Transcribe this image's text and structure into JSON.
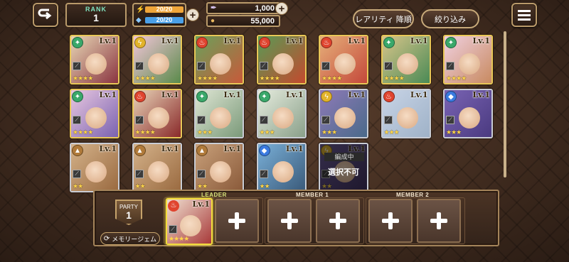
{
  "header": {
    "rank_label": "RANK",
    "rank_value": "1",
    "stamina_top": "20/20",
    "stamina_bottom": "20/20",
    "currency1_value": "1,000",
    "currency2_value": "55,000",
    "sort_button_label": "レアリティ 降順",
    "filter_button_label": "絞り込み"
  },
  "colors": {
    "accent_gold": "#e8c757",
    "frame": "#b99a6a",
    "leader_highlight": "#f3dd3e",
    "stamina_fill_top": "#f0a63a",
    "stamina_fill_bottom": "#4aa0e8"
  },
  "roster": [
    {
      "level": "Lv.1",
      "element": "wind",
      "frame": "gold",
      "art": [
        "#e8d7b5",
        "#8a3440"
      ],
      "stars": "★★★★",
      "status": "",
      "status_text": ""
    },
    {
      "level": "Lv.1",
      "element": "thunder",
      "frame": "gold",
      "art": [
        "#f2c6d8",
        "#5a8a4a"
      ],
      "stars": "★★★★",
      "status": "",
      "status_text": ""
    },
    {
      "level": "Lv.1",
      "element": "fire",
      "frame": "gold",
      "art": [
        "#6ba05a",
        "#c75a3a"
      ],
      "stars": "★★★★",
      "status": "",
      "status_text": ""
    },
    {
      "level": "Lv.1",
      "element": "fire",
      "frame": "gold",
      "art": [
        "#5a9a55",
        "#c34a2e"
      ],
      "stars": "★★★★",
      "status": "",
      "status_text": ""
    },
    {
      "level": "Lv.1",
      "element": "fire",
      "frame": "gold",
      "art": [
        "#e6b07a",
        "#c4483a"
      ],
      "stars": "★★★★",
      "status": "",
      "status_text": ""
    },
    {
      "level": "Lv.1",
      "element": "wind",
      "frame": "gold",
      "art": [
        "#d8c58a",
        "#4a8a55"
      ],
      "stars": "★★★★",
      "status": "",
      "status_text": ""
    },
    {
      "level": "Lv.1",
      "element": "wind",
      "frame": "gold",
      "art": [
        "#f0d0e0",
        "#c88a60"
      ],
      "stars": "★★★★",
      "status": "",
      "status_text": ""
    },
    {
      "level": "Lv.1",
      "element": "wind",
      "frame": "gold",
      "art": [
        "#e9c8e0",
        "#7a62b0"
      ],
      "stars": "★★★★",
      "status": "",
      "status_text": ""
    },
    {
      "level": "Lv.1",
      "element": "fire",
      "frame": "gold",
      "art": [
        "#e8d4b8",
        "#8a2a2a"
      ],
      "stars": "★★★★",
      "status": "",
      "status_text": ""
    },
    {
      "level": "Lv.1",
      "element": "wind",
      "frame": "silver",
      "art": [
        "#dfe6d4",
        "#7b9a7a"
      ],
      "stars": "★★★",
      "status": "",
      "status_text": ""
    },
    {
      "level": "Lv.1",
      "element": "wind",
      "frame": "silver",
      "art": [
        "#e6ecde",
        "#8aa08a"
      ],
      "stars": "★★★",
      "status": "",
      "status_text": ""
    },
    {
      "level": "Lv.1",
      "element": "thunder",
      "frame": "silver",
      "art": [
        "#8f7ab8",
        "#4a6a8a"
      ],
      "stars": "★★★",
      "status": "",
      "status_text": ""
    },
    {
      "level": "Lv.1",
      "element": "fire",
      "frame": "silver",
      "art": [
        "#c8d4e6",
        "#9fb2c8"
      ],
      "stars": "★★★",
      "status": "",
      "status_text": ""
    },
    {
      "level": "Lv.1",
      "element": "water",
      "frame": "silver",
      "art": [
        "#7a64b4",
        "#4a3a80"
      ],
      "stars": "★★★",
      "status": "",
      "status_text": ""
    },
    {
      "level": "Lv.1",
      "element": "earth",
      "frame": "silver",
      "art": [
        "#d4b28a",
        "#9a6a40"
      ],
      "stars": "★★",
      "status": "",
      "status_text": ""
    },
    {
      "level": "Lv.1",
      "element": "earth",
      "frame": "silver",
      "art": [
        "#d4b28a",
        "#9a6a40"
      ],
      "stars": "★★",
      "status": "",
      "status_text": ""
    },
    {
      "level": "Lv.1",
      "element": "earth",
      "frame": "silver",
      "art": [
        "#c8a07a",
        "#8a5a3a"
      ],
      "stars": "★★",
      "status": "",
      "status_text": ""
    },
    {
      "level": "Lv.1",
      "element": "water",
      "frame": "silver",
      "art": [
        "#7ab0d8",
        "#3a5a7a"
      ],
      "stars": "★★",
      "status": "",
      "status_text": ""
    },
    {
      "level": "Lv.1",
      "element": "thunder",
      "frame": "silver",
      "art": [
        "#6a5a9a",
        "#3a2a5a"
      ],
      "stars": "★★",
      "status": "編成中",
      "status_text": "選択不可"
    }
  ],
  "party": {
    "badge_top": "PARTY",
    "badge_number": "1",
    "memory_gem_label": "メモリージェム",
    "leader_label": "LEADER",
    "member1_label": "MEMBER 1",
    "member2_label": "MEMBER 2",
    "leader_level": "Lv.1",
    "leader_stars": "★★★★"
  }
}
